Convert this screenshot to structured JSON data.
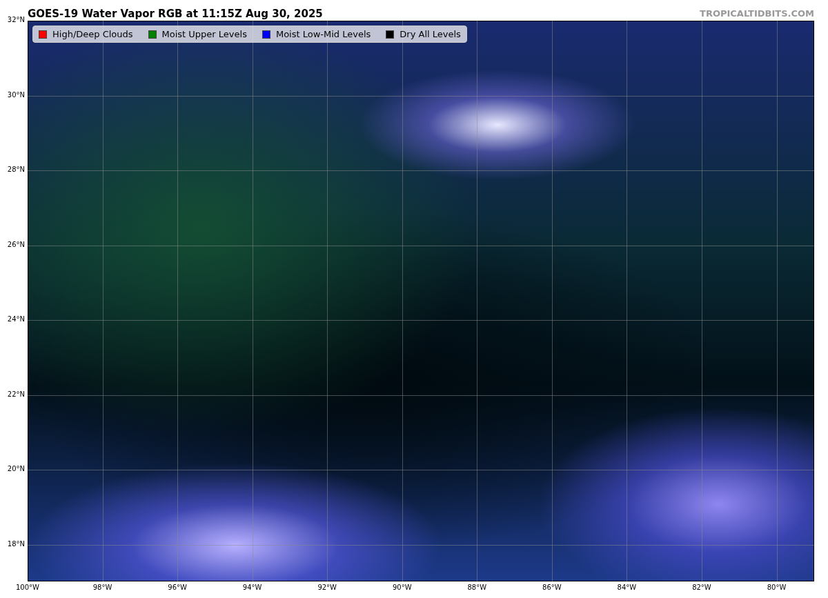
{
  "title": "GOES-19 Water Vapor RGB at 11:15Z Aug 30, 2025",
  "credit": "TROPICALTIDBITS.COM",
  "legend": [
    {
      "label": "High/Deep Clouds",
      "color": "#ff0000"
    },
    {
      "label": "Moist Upper Levels",
      "color": "#008000"
    },
    {
      "label": "Moist Low-Mid Levels",
      "color": "#0000ff"
    },
    {
      "label": "Dry All Levels",
      "color": "#000000"
    }
  ],
  "map": {
    "lat_labels": [
      "32°N",
      "30°N",
      "28°N",
      "26°N",
      "24°N",
      "22°N",
      "20°N",
      "18°N"
    ],
    "lon_labels": [
      "100°W",
      "98°W",
      "96°W",
      "94°W",
      "92°W",
      "90°W",
      "88°W",
      "86°W",
      "84°W",
      "82°W",
      "80°W"
    ]
  }
}
